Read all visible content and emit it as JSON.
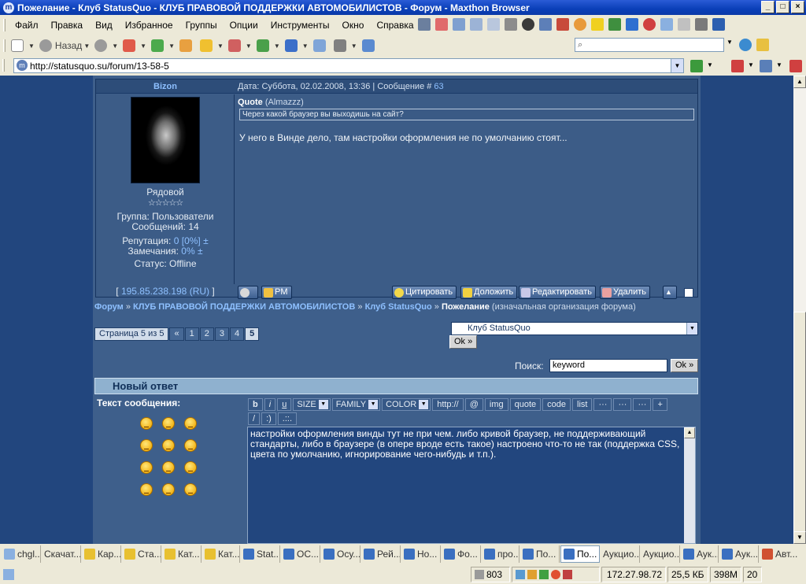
{
  "window": {
    "title": "Пожелание - Клуб StatusQuo - КЛУБ ПРАВОВОЙ ПОДДЕРЖКИ АВТОМОБИЛИСТОВ - Форум - Maxthon Browser",
    "app_icon": "m",
    "buttons": [
      "_",
      "□",
      "×"
    ]
  },
  "menu": [
    "Файл",
    "Правка",
    "Вид",
    "Избранное",
    "Группы",
    "Опции",
    "Инструменты",
    "Окно",
    "Справка"
  ],
  "toolbar": {
    "back_label": "Назад"
  },
  "address": {
    "url": "http://statusquo.su/forum/13-58-5"
  },
  "post": {
    "author": "Bizon",
    "meta_prefix": "Дата: Суббота, 02.02.2008, 13:36 | Сообщение #",
    "msg_no": "63",
    "rank": "Рядовой",
    "stars": "☆☆☆☆☆",
    "group": "Группа: Пользователи",
    "messages": "Сообщений: 14",
    "rep_label": "Репутация:",
    "rep_value": "0 [0%]",
    "rep_pm": "±",
    "warn_label": "Замечания:",
    "warn_value": "0%",
    "warn_pm": "±",
    "status": "Статус: Offline",
    "quote_label": "Quote",
    "quote_author": "(Almazzz)",
    "quote_text": "Через какой браузер вы выходишь на сайт?",
    "message": "У него в Винде дело, там настройки оформления не по умолчанию стоят...",
    "ip_open": "[",
    "ip": "195.85.238.198",
    "ip_cc_open": "(",
    "ip_cc": "RU",
    "ip_cc_close": ")",
    "ip_close": "]",
    "buttons": {
      "pm": "PM",
      "quote": "Цитировать",
      "report": "Доложить",
      "edit": "Редактировать",
      "delete": "Удалить"
    }
  },
  "breadcrumbs": {
    "forum": "Форум",
    "sep": "»",
    "section": "КЛУБ ПРАВОВОЙ ПОДДЕРЖКИ АВТОМОБИЛИСТОВ",
    "club": "Клуб StatusQuo",
    "topic": "Пожелание",
    "topic_desc": "(изначальная организация форума)"
  },
  "pager": {
    "label": "Страница 5 из 5",
    "prev": "«",
    "pages": [
      "1",
      "2",
      "3",
      "4",
      "5"
    ],
    "current": "5"
  },
  "jump": {
    "selected": "Клуб StatusQuo",
    "ok": "Ok »"
  },
  "search": {
    "label": "Поиск:",
    "value": "keyword",
    "ok": "Ok »"
  },
  "reply": {
    "header": "Новый ответ",
    "text_label": "Текст сообщения:",
    "bbcodes": {
      "b": "b",
      "i": "i",
      "u": "u",
      "size": "SIZE",
      "family": "FAMILY",
      "color": "COLOR",
      "http": "http://",
      "at": "@",
      "img": "img",
      "quote": "quote",
      "code": "code",
      "list": "list",
      "more1": "···",
      "more2": "···",
      "more3": "···",
      "plus": "+",
      "slash": "/",
      "smile": ":)",
      "dots": ".::."
    },
    "text": "настройки оформления винды тут не при чем. либо кривой браузер, не поддерживающий стандарты, либо в браузере (в опере вроде есть такое) настроено что-то не так (поддержка CSS, цвета по умолчанию, игнорирование чего-нибудь и т.п.)."
  },
  "tabs": [
    "chgl...",
    "Скачат...",
    "Кар...",
    "Ста...",
    "Кат...",
    "Кат...",
    "Stat...",
    "ОС...",
    "Осу...",
    "Рей...",
    "Но...",
    "Фо...",
    "про...",
    "По...",
    "По...",
    "Аукцио...",
    "Аукцио...",
    "Аук...",
    "Аук...",
    "Авт..."
  ],
  "active_tab": "По...",
  "status": {
    "count": "803",
    "ip": "172.27.98.72",
    "size": "25,5 КБ",
    "mem": "398M",
    "num": "20"
  }
}
